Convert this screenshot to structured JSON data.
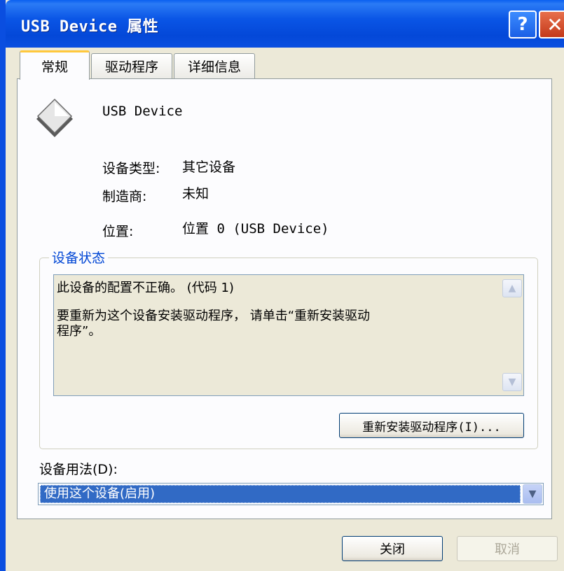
{
  "window": {
    "title": "USB Device 属性",
    "help_glyph": "?",
    "close_glyph": "✕"
  },
  "tabs": [
    {
      "label": "常规",
      "active": true
    },
    {
      "label": "驱动程序",
      "active": false
    },
    {
      "label": "详细信息",
      "active": false
    }
  ],
  "device": {
    "icon": "usb-device-diamond-icon",
    "name": "USB Device",
    "type_label": "设备类型:",
    "type_value": "其它设备",
    "manufacturer_label": "制造商:",
    "manufacturer_value": "未知",
    "location_label": "位置:",
    "location_value": "位置 0 (USB Device)"
  },
  "status_group": {
    "title": "设备状态",
    "line1": "此设备的配置不正确。 (代码 1)",
    "line2": "要重新为这个设备安装驱动程序， 请单击“重新安装驱动",
    "line3": "程序”。",
    "reinstall_button": "重新安装驱动程序(I)..."
  },
  "usage": {
    "label": "设备用法(D):",
    "selected_value": "使用这个设备(启用)"
  },
  "footer": {
    "close_button": "关闭",
    "cancel_button": "取消"
  },
  "colors": {
    "titlebar": "#0a4ee0",
    "dialog_bg": "#ece9d8",
    "selection": "#316ac5",
    "group_title": "#0046d5"
  }
}
